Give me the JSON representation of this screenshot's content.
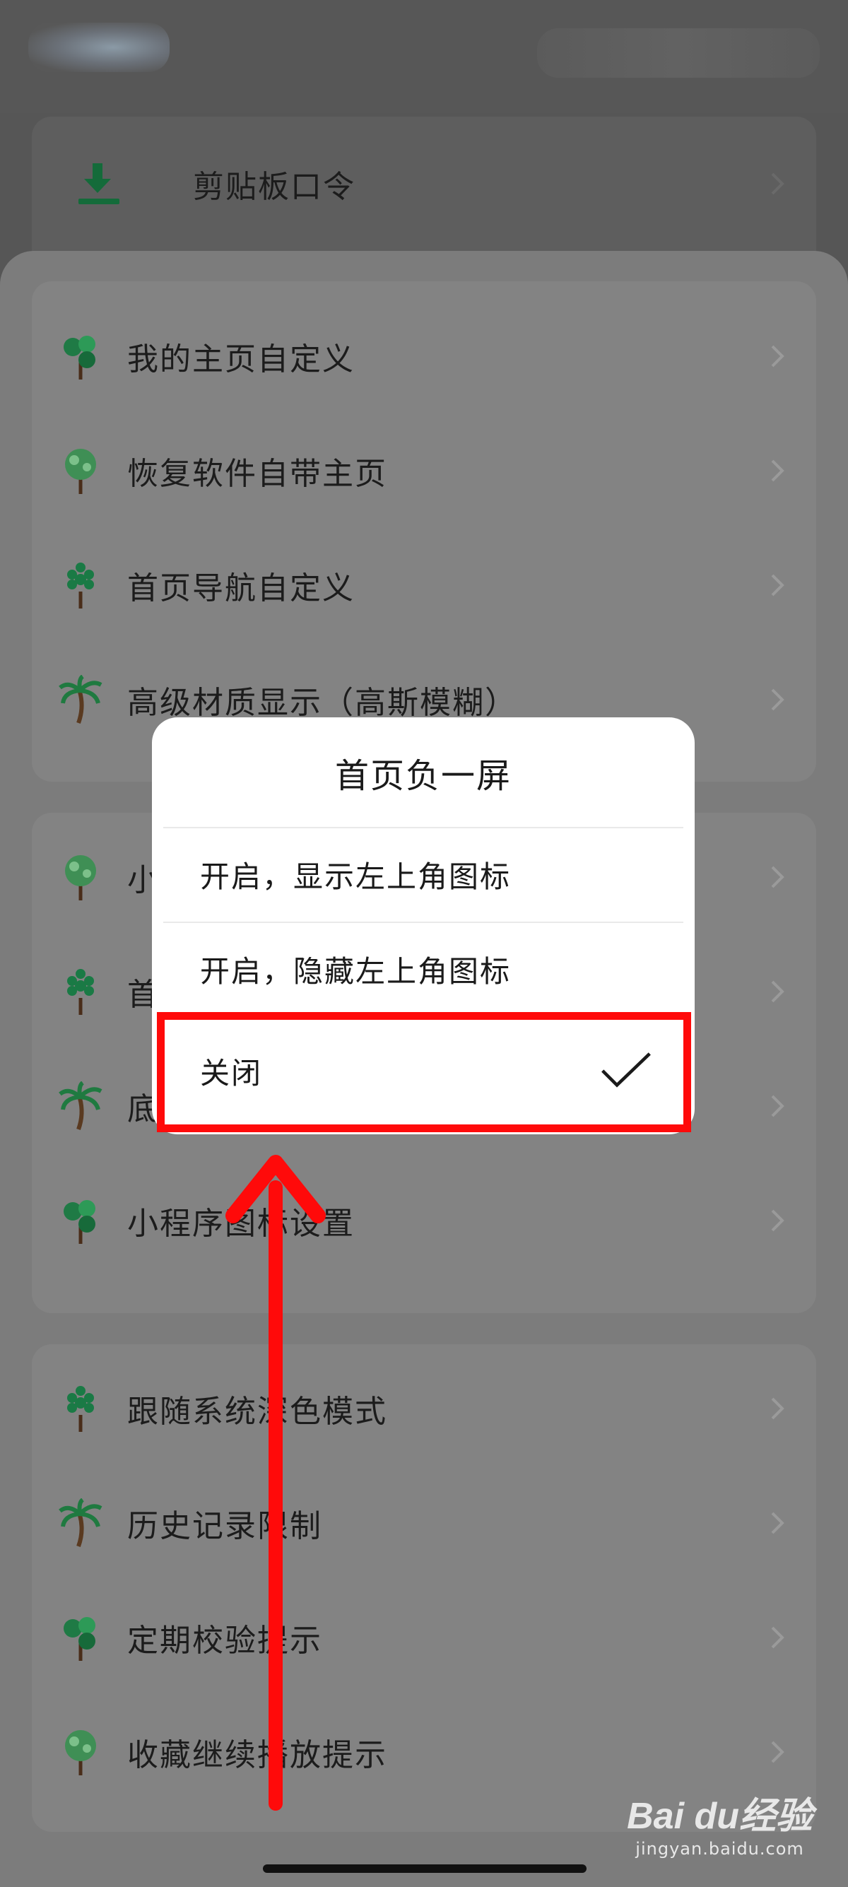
{
  "top_card": {
    "label": "剪贴板口令",
    "icon": "download-icon"
  },
  "group1": [
    {
      "label": "我的主页自定义",
      "icon": "tree-icon-a"
    },
    {
      "label": "恢复软件自带主页",
      "icon": "tree-icon-b"
    },
    {
      "label": "首页导航自定义",
      "icon": "tree-icon-c"
    },
    {
      "label": "高级材质显示（高斯模糊）",
      "icon": "palm-icon"
    }
  ],
  "group2": [
    {
      "label": "小",
      "icon": "tree-icon-b"
    },
    {
      "label": "首",
      "icon": "tree-icon-c"
    },
    {
      "label": "底",
      "icon": "palm-icon"
    },
    {
      "label": "小程序图标设置",
      "icon": "tree-icon-a"
    }
  ],
  "group3": [
    {
      "label": "跟随系统深色模式",
      "icon": "tree-icon-c"
    },
    {
      "label": "历史记录限制",
      "icon": "palm-icon"
    },
    {
      "label": "定期校验提示",
      "icon": "tree-icon-a"
    },
    {
      "label": "收藏继续播放提示",
      "icon": "tree-icon-b"
    }
  ],
  "dialog": {
    "title": "首页负一屏",
    "options": [
      {
        "label": "开启，显示左上角图标",
        "selected": false
      },
      {
        "label": "开启，隐藏左上角图标",
        "selected": false
      },
      {
        "label": "关闭",
        "selected": true
      }
    ]
  },
  "watermark": {
    "main": "Bai du经验",
    "sub": "jingyan.baidu.com"
  },
  "colors": {
    "highlight": "#ff0a0a",
    "accent_green": "#1a7a4a"
  }
}
